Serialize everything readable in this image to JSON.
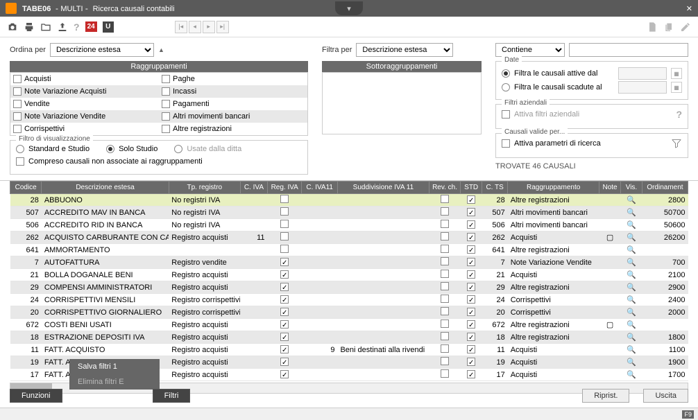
{
  "titlebar": {
    "code": "TABE06",
    "multi": "MULTI",
    "title_rest": "Ricerca causali contabili"
  },
  "toolbar": {
    "badge": "24"
  },
  "ordina": {
    "label": "Ordina per",
    "value": "Descrizione estesa"
  },
  "filtra": {
    "label": "Filtra per",
    "value": "Descrizione estesa",
    "op": "Contiene"
  },
  "gruppi": {
    "header": "Raggruppamenti",
    "col1": [
      "Acquisti",
      "Note Variazione Acquisti",
      "Vendite",
      "Note Variazione Vendite",
      "Corrispettivi"
    ],
    "col2": [
      "Paghe",
      "Incassi",
      "Pagamenti",
      "Altri movimenti bancari",
      "Altre registrazioni"
    ]
  },
  "sottogruppi": {
    "header": "Sottoraggruppamenti"
  },
  "filtro_vis": {
    "legend": "Filtro di visualizzazione",
    "opt1": "Standard e Studio",
    "opt2": "Solo Studio",
    "opt3": "Usate dalla ditta",
    "chk_label": "Compreso causali non associate ai raggruppamenti"
  },
  "date_box": {
    "legend": "Date",
    "opt1": "Filtra le causali attive dal",
    "opt2": "Filtra le causali scadute al"
  },
  "aziendali": {
    "legend": "Filtri aziendali",
    "chk": "Attiva filtri aziendali"
  },
  "valide": {
    "legend": "Causali valide per...",
    "chk": "Attiva parametri di ricerca"
  },
  "found": "TROVATE 46 CAUSALI",
  "headers": [
    "Codice",
    "Descrizione estesa",
    "Tp. registro",
    "C. IVA",
    "Reg. IVA",
    "C. IVA11",
    "Suddivisione IVA 11",
    "Rev. ch.",
    "STD",
    "C. TS",
    "Raggruppamento",
    "Note",
    "Vis.",
    "Ordinament"
  ],
  "rows": [
    {
      "cod": 28,
      "desc": "ABBUONO",
      "tp": "No registri IVA",
      "civa": "",
      "reg": false,
      "c11": "",
      "sudd": "",
      "rev": false,
      "std": true,
      "cts": 28,
      "ragg": "Altre registrazioni",
      "note": "",
      "ord": 2800,
      "hl": true
    },
    {
      "cod": 507,
      "desc": "ACCREDITO MAV IN BANCA",
      "tp": "No registri IVA",
      "civa": "",
      "reg": false,
      "c11": "",
      "sudd": "",
      "rev": false,
      "std": true,
      "cts": 507,
      "ragg": "Altri movimenti bancari",
      "note": "",
      "ord": 50700
    },
    {
      "cod": 506,
      "desc": "ACCREDITO RID IN BANCA",
      "tp": "No registri IVA",
      "civa": "",
      "reg": false,
      "c11": "",
      "sudd": "",
      "rev": false,
      "std": true,
      "cts": 506,
      "ragg": "Altri movimenti bancari",
      "note": "",
      "ord": 50600
    },
    {
      "cod": 262,
      "desc": "ACQUISTO CARBURANTE CON CA",
      "tp": "Registro acquisti",
      "civa": "11",
      "reg": false,
      "c11": "",
      "sudd": "",
      "rev": false,
      "std": true,
      "cts": 262,
      "ragg": "Acquisti",
      "note": "n",
      "ord": 26200
    },
    {
      "cod": 641,
      "desc": "AMMORTAMENTO",
      "tp": "",
      "civa": "",
      "reg": false,
      "c11": "",
      "sudd": "",
      "rev": false,
      "std": true,
      "cts": 641,
      "ragg": "Altre registrazioni",
      "note": "",
      "ord": ""
    },
    {
      "cod": 7,
      "desc": "AUTOFATTURA",
      "tp": "Registro vendite",
      "civa": "",
      "reg": true,
      "c11": "",
      "sudd": "",
      "rev": false,
      "std": true,
      "cts": 7,
      "ragg": "Note Variazione Vendite",
      "note": "",
      "ord": 700
    },
    {
      "cod": 21,
      "desc": "BOLLA DOGANALE BENI",
      "tp": "Registro acquisti",
      "civa": "",
      "reg": true,
      "c11": "",
      "sudd": "",
      "rev": false,
      "std": true,
      "cts": 21,
      "ragg": "Acquisti",
      "note": "",
      "ord": 2100
    },
    {
      "cod": 29,
      "desc": "COMPENSI AMMINISTRATORI",
      "tp": "Registro acquisti",
      "civa": "",
      "reg": true,
      "c11": "",
      "sudd": "",
      "rev": false,
      "std": true,
      "cts": 29,
      "ragg": "Altre registrazioni",
      "note": "",
      "ord": 2900
    },
    {
      "cod": 24,
      "desc": "CORRISPETTIVI MENSILI",
      "tp": "Registro corrispettivi",
      "civa": "",
      "reg": true,
      "c11": "",
      "sudd": "",
      "rev": false,
      "std": true,
      "cts": 24,
      "ragg": "Corrispettivi",
      "note": "",
      "ord": 2400
    },
    {
      "cod": 20,
      "desc": "CORRISPETTIVO GIORNALIERO",
      "tp": "Registro corrispettivi",
      "civa": "",
      "reg": true,
      "c11": "",
      "sudd": "",
      "rev": false,
      "std": true,
      "cts": 20,
      "ragg": "Corrispettivi",
      "note": "",
      "ord": 2000
    },
    {
      "cod": 672,
      "desc": "COSTI BENI USATI",
      "tp": "Registro acquisti",
      "civa": "",
      "reg": true,
      "c11": "",
      "sudd": "",
      "rev": false,
      "std": true,
      "cts": 672,
      "ragg": "Altre registrazioni",
      "note": "n",
      "ord": ""
    },
    {
      "cod": 18,
      "desc": "ESTRAZIONE DEPOSITI IVA",
      "tp": "Registro acquisti",
      "civa": "",
      "reg": true,
      "c11": "",
      "sudd": "",
      "rev": false,
      "std": true,
      "cts": 18,
      "ragg": "Altre registrazioni",
      "note": "",
      "ord": 1800
    },
    {
      "cod": 11,
      "desc": "FATT. ACQUISTO",
      "tp": "Registro acquisti",
      "civa": "",
      "reg": true,
      "c11": "9",
      "sudd": "Beni destinati alla rivendi",
      "rev": false,
      "std": true,
      "cts": 11,
      "ragg": "Acquisti",
      "note": "",
      "ord": 1100
    },
    {
      "cod": 19,
      "desc": "FATT. ACQUISTO INTRA",
      "tp": "Registro acquisti",
      "civa": "",
      "reg": true,
      "c11": "",
      "sudd": "",
      "rev": false,
      "std": true,
      "cts": 19,
      "ragg": "Acquisti",
      "note": "",
      "ord": 1900
    },
    {
      "cod": 17,
      "desc": "FATT. ACQUISTO RSM",
      "tp": "Registro acquisti",
      "civa": "",
      "reg": true,
      "c11": "",
      "sudd": "",
      "rev": false,
      "std": true,
      "cts": 17,
      "ragg": "Acquisti",
      "note": "",
      "ord": 1700
    }
  ],
  "popup": {
    "save": "Salva filtri 1",
    "del": "Elimina filtri E"
  },
  "footer": {
    "funzioni": "Funzioni",
    "filtri": "Filtri",
    "riprist": "Riprist.",
    "uscita": "Uscita"
  },
  "statusbar": {
    "key": "F9"
  }
}
